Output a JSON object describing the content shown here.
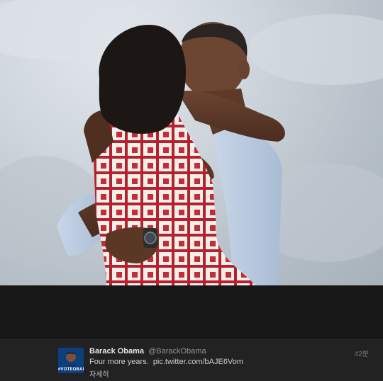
{
  "tweet": {
    "name": "Barack Obama",
    "handle": "@BarackObama",
    "text": "Four more years.",
    "link": "pic.twitter.com/bAJE6Vom",
    "details": "자세히",
    "time": "42분"
  },
  "avatar": {
    "badge": "#VOTEOBAMA"
  },
  "colors": {
    "background": "#151515",
    "tweet_bar": "#222222",
    "sky": "#c9d1d8"
  }
}
